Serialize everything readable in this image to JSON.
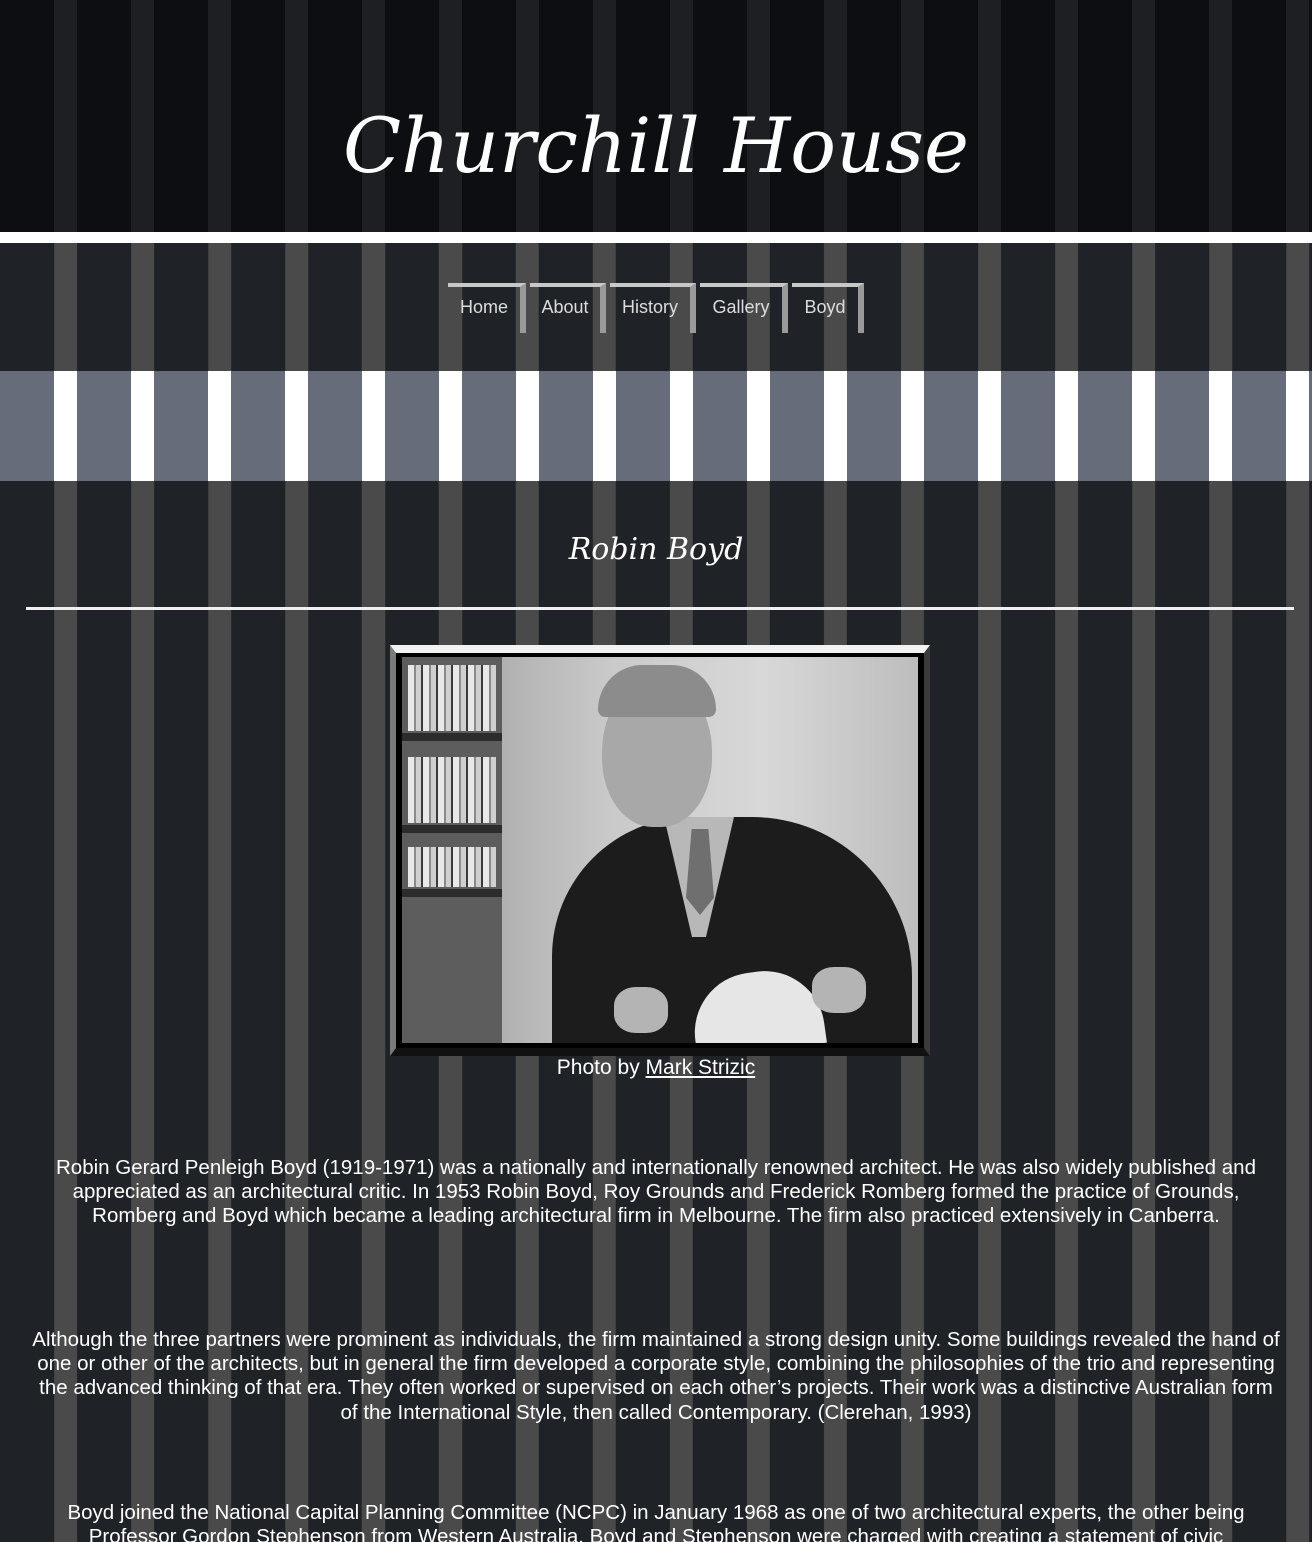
{
  "site": {
    "title": "Churchill House"
  },
  "nav": {
    "items": [
      {
        "label": "Home"
      },
      {
        "label": "About"
      },
      {
        "label": "History"
      },
      {
        "label": "Gallery"
      },
      {
        "label": "Boyd"
      }
    ]
  },
  "main": {
    "heading": "Robin Boyd",
    "photo": {
      "alt": "Robin Boyd",
      "credit_prefix": "Photo by ",
      "credit_link": "Mark Strizic"
    },
    "paragraphs": [
      "Robin Gerard Penleigh Boyd (1919-1971) was a nationally and internationally renowned architect. He was also widely published and appreciated as an architectural critic. In 1953 Robin Boyd, Roy Grounds and Frederick Romberg formed the practice of Grounds, Romberg and Boyd which became a leading architectural firm in Melbourne. The firm also practiced extensively in Canberra.",
      "Although the three partners were prominent as individuals, the firm maintained a strong design unity. Some buildings revealed the hand of one or other of the architects, but in general the firm developed a corporate style, combining the philosophies of the trio and representing the advanced thinking of that era. They often worked or supervised on each other’s projects. Their work was a distinctive Australian form of the International Style, then called Contemporary. (Clerehan, 1993)",
      "Boyd joined the National Capital Planning Committee (NCPC) in January 1968 as one of two architectural experts, the other being Professor Gordon Stephenson from Western Australia. Boyd and Stephenson were charged with creating a statement of civic"
    ]
  },
  "colors": {
    "page_background": "#1f2227",
    "stripe": "#4a4a4a",
    "header_background": "#0d0e11",
    "band_background": "#676c7b",
    "text": "#ffffff"
  }
}
